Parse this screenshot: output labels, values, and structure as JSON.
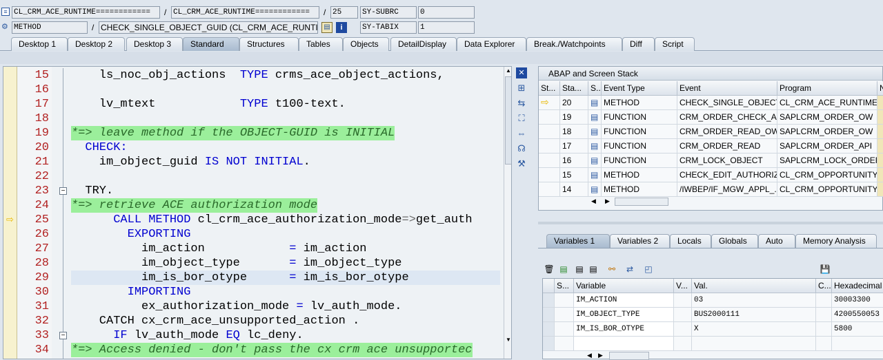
{
  "header": {
    "row1": {
      "program": "CL_CRM_ACE_RUNTIME============",
      "include": "CL_CRM_ACE_RUNTIME============",
      "line": "25",
      "sysfield_name": "SY-SUBRC",
      "sysfield_value": "0"
    },
    "row2": {
      "event_type": "METHOD",
      "event": "CHECK_SINGLE_OBJECT_GUID (CL_CRM_ACE_RUNTIME)",
      "sysfield_name": "SY-TABIX",
      "sysfield_value": "1"
    },
    "separator": "/"
  },
  "tabs": [
    {
      "label": "Desktop 1"
    },
    {
      "label": "Desktop 2"
    },
    {
      "label": "Desktop 3"
    },
    {
      "label": "Standard",
      "active": true
    },
    {
      "label": "Structures"
    },
    {
      "label": "Tables"
    },
    {
      "label": "Objects"
    },
    {
      "label": "DetailDisplay"
    },
    {
      "label": "Data Explorer"
    },
    {
      "label": "Break./Watchpoints"
    },
    {
      "label": "Diff"
    },
    {
      "label": "Script"
    }
  ],
  "code": {
    "current_line": 25,
    "lines": [
      {
        "n": "15",
        "text": "    ls_noc_obj_actions  TYPE crms_ace_object_actions,"
      },
      {
        "n": "16",
        "text": ""
      },
      {
        "n": "17",
        "text": "    lv_mtext            TYPE t100-text."
      },
      {
        "n": "18",
        "text": ""
      },
      {
        "n": "19",
        "text": "*=> leave method if the OBJECT-GUID is INITIAL"
      },
      {
        "n": "20",
        "text": "  CHECK:"
      },
      {
        "n": "21",
        "text": "    im_object_guid IS NOT INITIAL."
      },
      {
        "n": "22",
        "text": ""
      },
      {
        "n": "23",
        "text": "  TRY."
      },
      {
        "n": "24",
        "text": "*=> retrieve ACE authorization mode"
      },
      {
        "n": "25",
        "text": "      CALL METHOD cl_crm_ace_authorization_mode=>get_auth"
      },
      {
        "n": "26",
        "text": "        EXPORTING"
      },
      {
        "n": "27",
        "text": "          im_action            = im_action"
      },
      {
        "n": "28",
        "text": "          im_object_type       = im_object_type"
      },
      {
        "n": "29",
        "text": "          im_is_bor_otype      = im_is_bor_otype"
      },
      {
        "n": "30",
        "text": "        IMPORTING"
      },
      {
        "n": "31",
        "text": "          ex_authorization_mode = lv_auth_mode."
      },
      {
        "n": "32",
        "text": "    CATCH cx_crm_ace_unsupported_action ."
      },
      {
        "n": "33",
        "text": "      IF lv_auth_mode EQ lc_deny."
      },
      {
        "n": "34",
        "text": "*=> Access denied - don't pass the cx crm ace unsupportec"
      }
    ]
  },
  "stack": {
    "title": "ABAP and Screen Stack",
    "columns": [
      "St...",
      "Sta...",
      "S...",
      "Event Type",
      "Event",
      "Program",
      "N"
    ],
    "rows": [
      {
        "current": true,
        "level": "20",
        "event_type": "METHOD",
        "event": "CHECK_SINGLE_OBJECT_...",
        "program": "CL_CRM_ACE_RUNTIME..."
      },
      {
        "current": false,
        "level": "19",
        "event_type": "FUNCTION",
        "event": "CRM_ORDER_CHECK_AU...",
        "program": "SAPLCRM_ORDER_OW"
      },
      {
        "current": false,
        "level": "18",
        "event_type": "FUNCTION",
        "event": "CRM_ORDER_READ_OW",
        "program": "SAPLCRM_ORDER_OW"
      },
      {
        "current": false,
        "level": "17",
        "event_type": "FUNCTION",
        "event": "CRM_ORDER_READ",
        "program": "SAPLCRM_ORDER_API"
      },
      {
        "current": false,
        "level": "16",
        "event_type": "FUNCTION",
        "event": "CRM_LOCK_OBJECT",
        "program": "SAPLCRM_LOCK_ORDER"
      },
      {
        "current": false,
        "level": "15",
        "event_type": "METHOD",
        "event": "CHECK_EDIT_AUTHORIZ...",
        "program": "CL_CRM_OPPORTUNITY..."
      },
      {
        "current": false,
        "level": "14",
        "event_type": "METHOD",
        "event": "/IWBEP/IF_MGW_APPL_...",
        "program": "CL_CRM_OPPORTUNITY..."
      }
    ]
  },
  "var_tabs": [
    {
      "label": "Variables 1",
      "active": true
    },
    {
      "label": "Variables 2"
    },
    {
      "label": "Locals"
    },
    {
      "label": "Globals"
    },
    {
      "label": "Auto"
    },
    {
      "label": "Memory Analysis"
    }
  ],
  "vars": {
    "columns": [
      "S...",
      "Variable",
      "V...",
      "Val.",
      "C...",
      "Hexadecimal"
    ],
    "rows": [
      {
        "name": "IM_ACTION",
        "value": "03",
        "hex": "30003300"
      },
      {
        "name": "IM_OBJECT_TYPE",
        "value": "BUS2000111",
        "hex": "4200550053"
      },
      {
        "name": "IM_IS_BOR_OTYPE",
        "value": "X",
        "hex": "5800"
      },
      {
        "name": "",
        "value": "",
        "hex": ""
      }
    ]
  },
  "colors": {
    "comment_bg": "#9bef9b",
    "keyword": "#0000d0",
    "line_number": "#b22222",
    "current_arrow": "#e8b800"
  }
}
